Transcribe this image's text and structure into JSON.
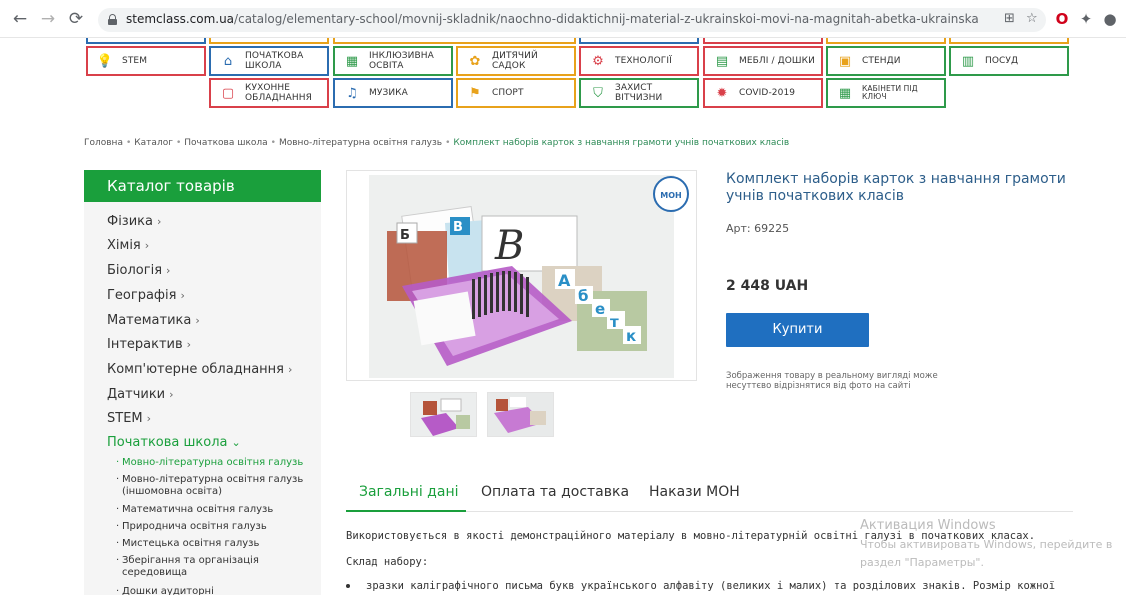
{
  "browser": {
    "url_host": "stemclass.com.ua",
    "url_path": "/catalog/elementary-school/movnij-skladnik/naochno-didaktichnij-material-z-ukrainskoi-movi-na-magnitah-abetka-ukrainska"
  },
  "menu_tiles": [
    {
      "label": "STEM",
      "icon": "lightbulb-icon",
      "color": "#d9404a"
    },
    {
      "label": "ПОЧАТКОВА ШКОЛА",
      "icon": "school-icon",
      "color": "#2b6cb0"
    },
    {
      "label": "ІНКЛЮЗИВНА ОСВІТА",
      "icon": "inclusive-icon",
      "color": "#2e9a4a"
    },
    {
      "label": "ДИТЯЧИЙ САДОК",
      "icon": "kindergarten-icon",
      "color": "#e8a21b"
    },
    {
      "label": "ТЕХНОЛОГІЇ",
      "icon": "technology-icon",
      "color": "#d9404a"
    },
    {
      "label": "МЕБЛІ / ДОШКИ",
      "icon": "furniture-icon",
      "color": "#d9404a"
    },
    {
      "label": "СТЕНДИ",
      "icon": "stand-icon",
      "color": "#d9404a"
    },
    {
      "label": "ПОСУД",
      "icon": "dishes-icon",
      "color": "#2e9a4a"
    },
    {
      "label": "КУХОННЕ ОБЛАДНАННЯ",
      "icon": "kitchen-icon",
      "color": "#d9404a"
    },
    {
      "label": "МУЗИКА",
      "icon": "music-icon",
      "color": "#2b6cb0"
    },
    {
      "label": "СПОРТ",
      "icon": "sport-icon",
      "color": "#e8a21b"
    },
    {
      "label": "ЗАХИСТ ВІТЧИЗНИ",
      "icon": "shield-icon",
      "color": "#2e9a4a"
    },
    {
      "label": "COVID-2019",
      "icon": "virus-icon",
      "color": "#d9404a"
    },
    {
      "label": "КАБІНЕТИ ПІД КЛЮЧ",
      "icon": "cabinet-icon",
      "color": "#2e9a4a"
    }
  ],
  "breadcrumb": {
    "items": [
      "Головна",
      "Каталог",
      "Початкова школа",
      "Мовно-літературна освітня галузь"
    ],
    "current": "Комплект наборів карток з навчання грамоти учнів початкових класів"
  },
  "sidebar": {
    "header": "Каталог товарів",
    "categories": [
      {
        "label": "Фізика"
      },
      {
        "label": "Хімія"
      },
      {
        "label": "Біологія"
      },
      {
        "label": "Географія"
      },
      {
        "label": "Математика"
      },
      {
        "label": "Інтерактив"
      },
      {
        "label": "Комп'ютерне обладнання"
      },
      {
        "label": "Датчики"
      },
      {
        "label": "STEM"
      },
      {
        "label": "Початкова школа"
      }
    ],
    "subcategories": [
      "Мовно-літературна освітня галузь",
      "Мовно-літературна освітня галузь (іншомовна освіта)",
      "Математична освітня галузь",
      "Природнича освітня галузь",
      "Мистецька освітня галузь",
      "Зберігання та організація середовища",
      "Дошки аудиторні"
    ]
  },
  "product": {
    "title": "Комплект наборів карток з навчання грамоти учнів початкових класів",
    "article": "Арт: 69225",
    "price": "2 448 UAH",
    "buy_label": "Купити",
    "disclaimer": "Зображення товару в реальному вигляді може несуттєво відрізнятися від фото на сайті",
    "badge": "МОН"
  },
  "tabs": [
    "Загальні дані",
    "Оплата та доставка",
    "Накази МОН"
  ],
  "description": {
    "line1": "Використовується в якості демонстраційного матеріалу в мовно-літературній освітні галузі в початкових класах.",
    "line2": "Склад набору:",
    "bullet1": "зразки каліграфічного письма букв українського алфавіту (великих і малих) та розділових знаків. Розмір кожної"
  },
  "watermark": {
    "title": "Активация Windows",
    "line1": "Чтобы активировать Windows, перейдите в",
    "line2": "раздел \"Параметры\"."
  }
}
